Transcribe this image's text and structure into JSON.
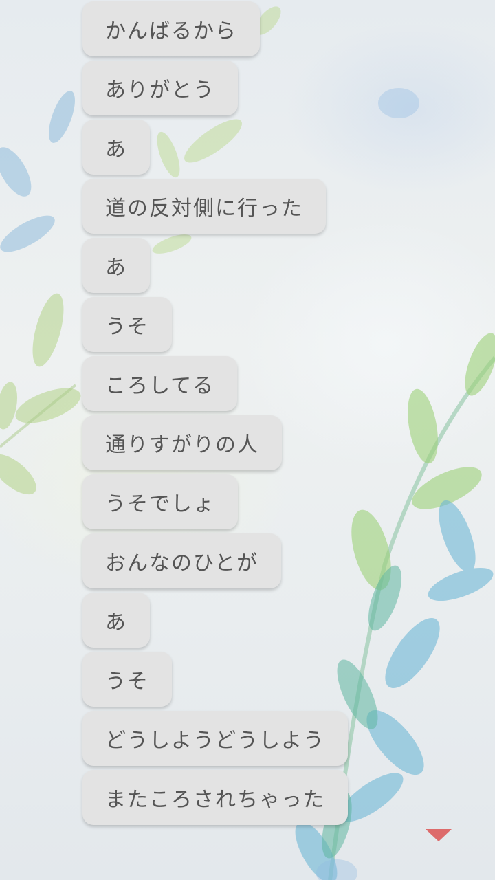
{
  "messages": [
    "かんばるから",
    "ありがとう",
    "あ",
    "道の反対側に行った",
    "あ",
    "うそ",
    "ころしてる",
    "通りすがりの人",
    "うそでしょ",
    "おんなのひとが",
    "あ",
    "うそ",
    "どうしようどうしよう",
    "またころされちゃった"
  ],
  "scroll_indicator": {
    "icon": "triangle-down-icon",
    "color": "#dd6b6b"
  }
}
